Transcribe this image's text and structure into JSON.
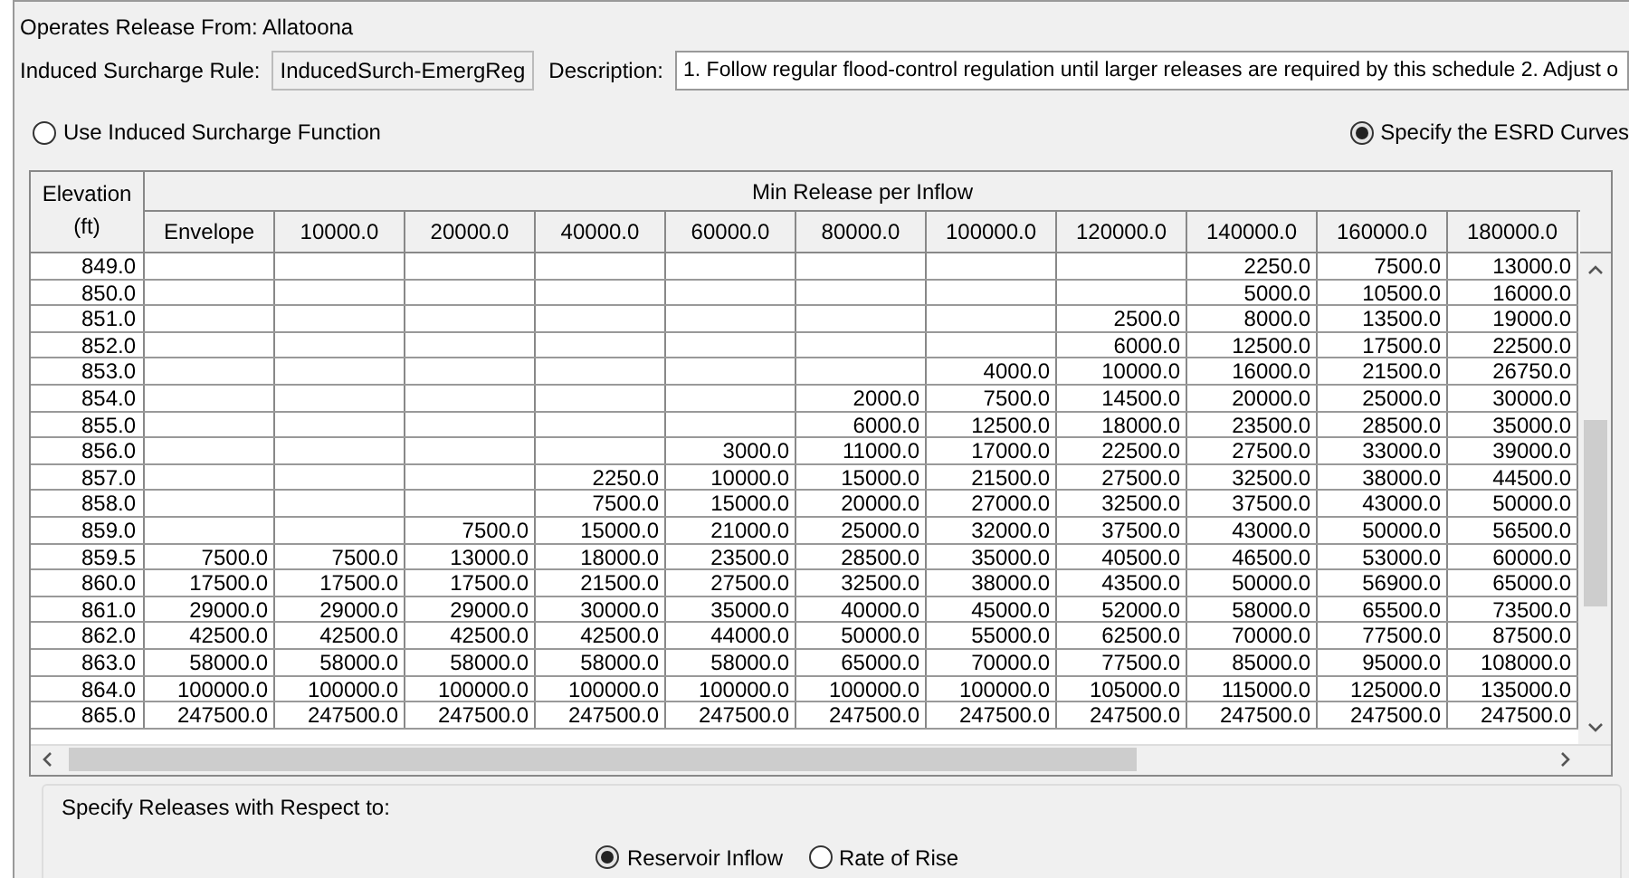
{
  "operates_release_from": "Operates Release From: Allatoona",
  "rule": {
    "label": "Induced Surcharge Rule:",
    "value": "InducedSurch-EmergReg"
  },
  "description": {
    "label": "Description:",
    "value": "1. Follow regular flood-control regulation until larger releases are required by this schedule 2. Adjust o"
  },
  "method_options": [
    {
      "label": "Use Induced Surcharge Function",
      "selected": false
    },
    {
      "label": "Specify the ESRD Curves",
      "selected": true
    }
  ],
  "table": {
    "elevation_header": [
      "Elevation",
      "(ft)"
    ],
    "group_header": "Min Release per Inflow",
    "columns": [
      "Envelope",
      "10000.0",
      "20000.0",
      "40000.0",
      "60000.0",
      "80000.0",
      "100000.0",
      "120000.0",
      "140000.0",
      "160000.0",
      "180000.0"
    ],
    "rows": [
      {
        "elevation": "849.0",
        "values": [
          "2250.0",
          "7500.0",
          "13000.0"
        ]
      },
      {
        "elevation": "850.0",
        "values": [
          "5000.0",
          "10500.0",
          "16000.0"
        ]
      },
      {
        "elevation": "851.0",
        "values": [
          "2500.0",
          "8000.0",
          "13500.0",
          "19000.0"
        ]
      },
      {
        "elevation": "852.0",
        "values": [
          "6000.0",
          "12500.0",
          "17500.0",
          "22500.0"
        ]
      },
      {
        "elevation": "853.0",
        "values": [
          "4000.0",
          "10000.0",
          "16000.0",
          "21500.0",
          "26750.0"
        ]
      },
      {
        "elevation": "854.0",
        "values": [
          "2000.0",
          "7500.0",
          "14500.0",
          "20000.0",
          "25000.0",
          "30000.0"
        ]
      },
      {
        "elevation": "855.0",
        "values": [
          "6000.0",
          "12500.0",
          "18000.0",
          "23500.0",
          "28500.0",
          "35000.0"
        ]
      },
      {
        "elevation": "856.0",
        "values": [
          "3000.0",
          "11000.0",
          "17000.0",
          "22500.0",
          "27500.0",
          "33000.0",
          "39000.0"
        ]
      },
      {
        "elevation": "857.0",
        "values": [
          "2250.0",
          "10000.0",
          "15000.0",
          "21500.0",
          "27500.0",
          "32500.0",
          "38000.0",
          "44500.0"
        ]
      },
      {
        "elevation": "858.0",
        "values": [
          "7500.0",
          "15000.0",
          "20000.0",
          "27000.0",
          "32500.0",
          "37500.0",
          "43000.0",
          "50000.0"
        ]
      },
      {
        "elevation": "859.0",
        "values": [
          "7500.0",
          "15000.0",
          "21000.0",
          "25000.0",
          "32000.0",
          "37500.0",
          "43000.0",
          "50000.0",
          "56500.0"
        ]
      },
      {
        "elevation": "859.5",
        "values": [
          "7500.0",
          "7500.0",
          "13000.0",
          "18000.0",
          "23500.0",
          "28500.0",
          "35000.0",
          "40500.0",
          "46500.0",
          "53000.0",
          "60000.0"
        ]
      },
      {
        "elevation": "860.0",
        "values": [
          "17500.0",
          "17500.0",
          "17500.0",
          "21500.0",
          "27500.0",
          "32500.0",
          "38000.0",
          "43500.0",
          "50000.0",
          "56900.0",
          "65000.0"
        ]
      },
      {
        "elevation": "861.0",
        "values": [
          "29000.0",
          "29000.0",
          "29000.0",
          "30000.0",
          "35000.0",
          "40000.0",
          "45000.0",
          "52000.0",
          "58000.0",
          "65500.0",
          "73500.0"
        ]
      },
      {
        "elevation": "862.0",
        "values": [
          "42500.0",
          "42500.0",
          "42500.0",
          "42500.0",
          "44000.0",
          "50000.0",
          "55000.0",
          "62500.0",
          "70000.0",
          "77500.0",
          "87500.0"
        ]
      },
      {
        "elevation": "863.0",
        "values": [
          "58000.0",
          "58000.0",
          "58000.0",
          "58000.0",
          "58000.0",
          "65000.0",
          "70000.0",
          "77500.0",
          "85000.0",
          "95000.0",
          "108000.0"
        ]
      },
      {
        "elevation": "864.0",
        "values": [
          "100000.0",
          "100000.0",
          "100000.0",
          "100000.0",
          "100000.0",
          "100000.0",
          "100000.0",
          "105000.0",
          "115000.0",
          "125000.0",
          "135000.0"
        ]
      },
      {
        "elevation": "865.0",
        "values": [
          "247500.0",
          "247500.0",
          "247500.0",
          "247500.0",
          "247500.0",
          "247500.0",
          "247500.0",
          "247500.0",
          "247500.0",
          "247500.0",
          "247500.0"
        ]
      }
    ]
  },
  "releases_with_respect_to": {
    "title": "Specify Releases with Respect to:",
    "options": [
      {
        "label": "Reservoir Inflow",
        "selected": true
      },
      {
        "label": "Rate of Rise",
        "selected": false
      }
    ]
  }
}
